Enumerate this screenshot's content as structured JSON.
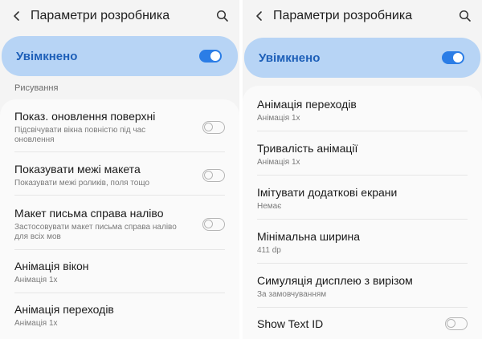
{
  "left": {
    "header": {
      "title": "Параметри розробника",
      "back_icon": "back-arrow-icon",
      "search_icon": "search-icon"
    },
    "master": {
      "label": "Увімкнено",
      "on": true
    },
    "section": "Рисування",
    "items": [
      {
        "label": "Показ. оновлення поверхні",
        "sub1": "Підсвічувати вікна повністю під час",
        "sub2": "оновлення",
        "toggle": "off"
      },
      {
        "label": "Показувати межі макета",
        "sub1": "Показувати межі роликів, поля тощо",
        "toggle": "off"
      },
      {
        "label": "Макет письма справа наліво",
        "sub1": "Застосовувати макет письма справа наліво",
        "sub2": "для всіх мов",
        "toggle": "off"
      },
      {
        "label": "Анімація вікон",
        "sub1": "Анімація 1x"
      },
      {
        "label": "Анімація переходів",
        "sub1": "Анімація 1x"
      }
    ]
  },
  "right": {
    "header": {
      "title": "Параметри розробника",
      "back_icon": "back-arrow-icon",
      "search_icon": "search-icon"
    },
    "master": {
      "label": "Увімкнено",
      "on": true
    },
    "items": [
      {
        "label": "Анімація переходів",
        "sub1": "Анімація 1x"
      },
      {
        "label": "Тривалість анімації",
        "sub1": "Анімація 1x"
      },
      {
        "label": "Імітувати додаткові екрани",
        "sub1": "Немає"
      },
      {
        "label": "Мінімальна ширина",
        "sub1": "411 dp"
      },
      {
        "label": "Симуляція дисплею з вирізом",
        "sub1": "За замовчуванням"
      },
      {
        "label": "Show Text ID",
        "toggle": "off"
      }
    ]
  },
  "colors": {
    "accent": "#2b7de6",
    "master_bg": "#b7d4f5",
    "master_text": "#1d5fb8"
  }
}
